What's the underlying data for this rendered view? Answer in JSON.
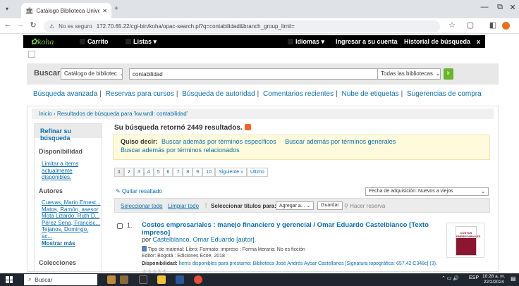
{
  "browser": {
    "tab_title": "Catálogo Biblioteca Universid...",
    "tab_close": "✕",
    "new_tab": "+",
    "window_controls": [
      "—",
      "⧉",
      "✕"
    ],
    "security_label": "No es seguro",
    "url": "172.70.65.22/cgi-bin/koha/opac-search.pl?q=contabilidad&branch_group_limit="
  },
  "koha_nav": {
    "logo": "koha",
    "cart": "Carrito",
    "lists": "Listas ▾",
    "languages": "Idiomas ▾",
    "login": "Ingresar a su cuenta",
    "history": "Historial de búsqueda",
    "history_close": "x"
  },
  "search": {
    "label": "Buscar",
    "index_value": "Catálogo de bibliotec",
    "query": "contabilidad",
    "library_value": "Todas las bibliotecas",
    "go_label": "Ir"
  },
  "more_searches": [
    "Búsqueda avanzada",
    "Reservas para cursos",
    "Búsqueda de autoridad",
    "Comentarios recientes",
    "Nube de etiquetas",
    "Sugerencias de compra"
  ],
  "breadcrumb": {
    "home": "Inicio",
    "separator": "›",
    "current": "Resultados de búsqueda para 'kw,wrdl: contabilidad'"
  },
  "sidebar": {
    "refine": "Refinar su búsqueda",
    "availability_head": "Disponibilidad",
    "availability_link": [
      "Limitar a ítems",
      "actualmente",
      "disponibles."
    ],
    "authors_head": "Autores",
    "authors": [
      "Cuevas, Mario Ernest...",
      "Matos, Ramón, asesor",
      "Mota Lizardo, Ruth D...",
      "Pérez Sena, Francisc...",
      "Tejanos, Domingo,",
      "ac..."
    ],
    "show_more": "Mostrar más",
    "collections_head": "Colecciones"
  },
  "results": {
    "count_text": "Su búsqueda retornó 2449 resultados.",
    "did_you_mean_label": "Quiso decir:",
    "suggestions": [
      "Buscar además por términos específicos",
      "Buscar además por términos generales",
      "Buscar además por términos relacionados"
    ],
    "pages": [
      "1",
      "2",
      "3",
      "4",
      "5",
      "6",
      "7",
      "8",
      "9",
      "10",
      "Siguiente »",
      "Último"
    ],
    "remove_highlight": "Quitar resaltado",
    "sort_value": "Fecha de adquisición: Nuevos a viejos",
    "select_all": "Seleccionar todo",
    "clear_all": "Limpiar todo",
    "selected_titles": "Seleccionar títulos para:",
    "add_to_value": "Agregar a...",
    "save_label": "Guardar",
    "hold_label": "Hacer reserva"
  },
  "result_item": {
    "number": "1.",
    "title": "Costos empresariales : manejo financiero y gerencial / Omar Eduardo Castelblanco [Texto impreso]",
    "author_prefix": "por",
    "author": "Castelblanco, Omar Eduardo [autor].",
    "material": "Tipo de material: Libro; Formato: impreso ; Forma literaria: No es ficción",
    "publisher": "Editor: Bogotá : Ediciones Ecoe, 2018",
    "availability_label": "Disponibilidad:",
    "availability": "Ítems disponibles para préstamo: Biblioteca José Andrés Aybar Castellanos [Signatura topográfica: 657.42 C348c] (3).",
    "cover_text": "COSTOS EMPRESARIALES",
    "stars": "★★★★★"
  },
  "taskbar": {
    "search_placeholder": "Buscar",
    "lang": "ESP",
    "time": "10:28 a. m.",
    "date": "22/2/2024"
  }
}
